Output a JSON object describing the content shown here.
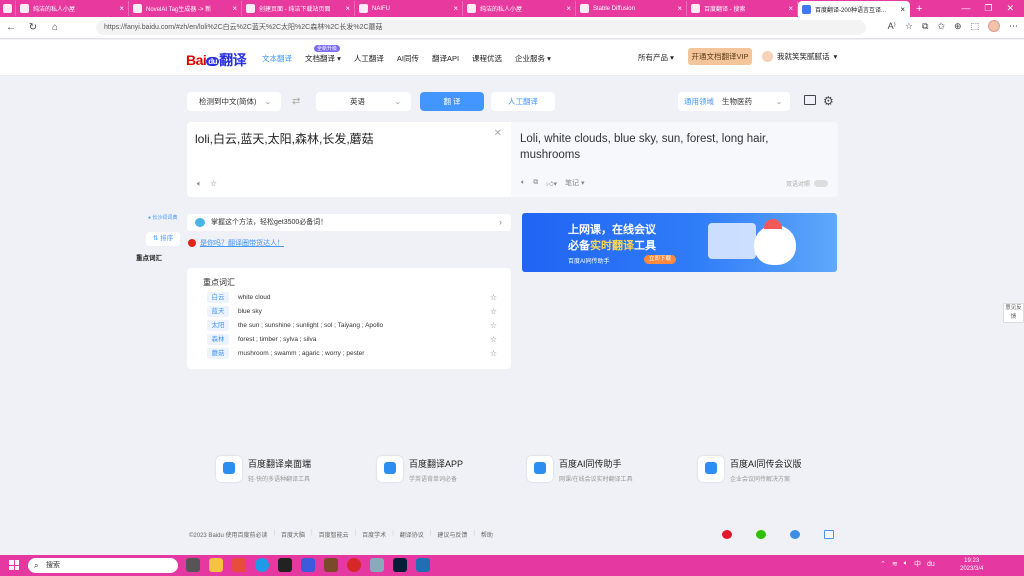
{
  "browser": {
    "tabs": [
      {
        "label": "纯洁的私人小屋",
        "active": false
      },
      {
        "label": "NovelAI Tag生成器 -> 新",
        "active": false
      },
      {
        "label": "创建页面 - 纯洁下载站页面",
        "active": false
      },
      {
        "label": "NAIFU",
        "active": false
      },
      {
        "label": "纯洁的私人小屋",
        "active": false
      },
      {
        "label": "Stable Diffusion",
        "active": false
      },
      {
        "label": "百度翻译 - 搜索",
        "active": false
      },
      {
        "label": "百度翻译-200种语言互译...",
        "active": true
      }
    ],
    "url": "https://fanyi.baidu.com/#zh/en/loli%2C白云%2C蓝天%2C太阳%2C森林%2C长发%2C蘑菇"
  },
  "header": {
    "logo_text": "Bai",
    "logo_du": "du",
    "logo_yi": "翻译",
    "nav": [
      "文本翻译",
      "文档翻译",
      "人工翻译",
      "AI同传",
      "翻译API",
      "课程优选",
      "企业服务"
    ],
    "nav_badge": "全新升级",
    "all_products": "所有产品",
    "vip_button": "开通文档翻译VIP",
    "username": "我就笑笑腻腻话"
  },
  "controls": {
    "source_lang": "检测到中文(简体)",
    "target_lang": "英语",
    "translate_button": "翻 译",
    "human_button": "人工翻译",
    "domain_label": "通用领域",
    "domain_value": "生物医药"
  },
  "input": {
    "text": "loli,白云,蓝天,太阳,森林,长发,蘑菇"
  },
  "output": {
    "text": "Loli, white clouds, blue sky, sun, forest, long hair, mushrooms",
    "notes_label": "笔记",
    "compare_label": "双语对照"
  },
  "sidenav": {
    "hint": "● 长沙词词典",
    "sort_label": "排序",
    "keywords_label": "重点词汇"
  },
  "tip": {
    "text": "掌握这个方法，轻松get3500必备词！",
    "promo": "是你吗？翻译圈带货达人！"
  },
  "vocab": {
    "title": "重点词汇",
    "rows": [
      {
        "word": "白云",
        "meaning": "white cloud"
      },
      {
        "word": "蓝天",
        "meaning": "blue sky"
      },
      {
        "word": "太阳",
        "meaning": "the sun ; sunshine ; sunlight ; sol ; Taiyang ; Apollo"
      },
      {
        "word": "森林",
        "meaning": "forest ; timber ; sylva ; silva"
      },
      {
        "word": "蘑菇",
        "meaning": "mushroom ; swamm ; agaric ; worry ; pester"
      }
    ]
  },
  "banner": {
    "line1": "上网课，在线会议",
    "line2_pre": "必备",
    "line2_hl": "实时翻译",
    "line2_post": "工具",
    "line3": "百度AI同传助手",
    "download": "立即下载"
  },
  "feedback": "意见反馈",
  "products": [
    {
      "name": "百度翻译桌面端",
      "desc": "轻·快的多语种翻译工具"
    },
    {
      "name": "百度翻译APP",
      "desc": "学英语背单词必备"
    },
    {
      "name": "百度AI同传助手",
      "desc": "网课/在线会议实时翻译工具"
    },
    {
      "name": "百度AI同传会议版",
      "desc": "企业会议同传解决方案"
    }
  ],
  "footer": [
    "©2023 Baidu  使用百度前必读",
    "百度大脑",
    "百度智能云",
    "百度学术",
    "翻译协议",
    "建议与反馈",
    "帮助"
  ],
  "taskbar": {
    "search_placeholder": "搜索",
    "time": "19:23",
    "date": "2023/3/4",
    "ime": "中"
  },
  "colors": {
    "accent": "#4395ff",
    "tabbar": "#e8399f",
    "taskbar": "#e538a0"
  }
}
